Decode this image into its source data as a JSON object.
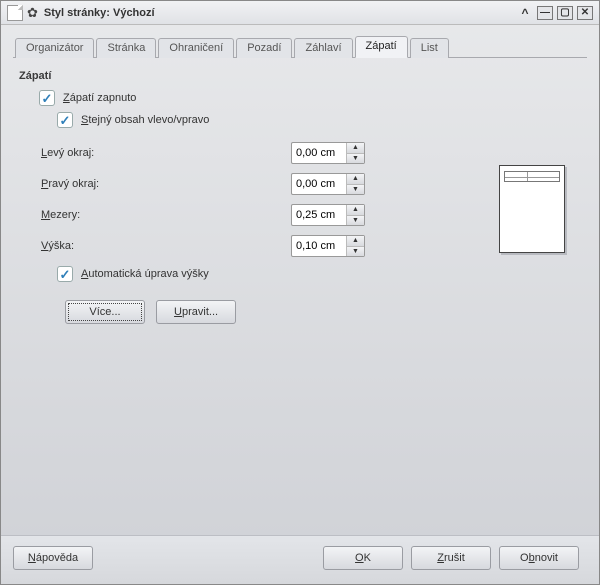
{
  "window": {
    "title": "Styl stránky: Výchozí",
    "btn_roll": "^",
    "btn_min": "—",
    "btn_max": "▢",
    "btn_close": "✕"
  },
  "tabs": {
    "items": [
      {
        "label": "Organizátor"
      },
      {
        "label": "Stránka"
      },
      {
        "label": "Ohraničení"
      },
      {
        "label": "Pozadí"
      },
      {
        "label": "Záhlaví"
      },
      {
        "label": "Zápatí"
      },
      {
        "label": "List"
      }
    ],
    "active_index": 5
  },
  "panel": {
    "title": "Zápatí",
    "footer_on": {
      "checked": true,
      "pre": "Z",
      "rest": "ápatí zapnuto"
    },
    "same_content": {
      "checked": true,
      "pre": "S",
      "rest": "tejný obsah vlevo/vpravo"
    },
    "fields": {
      "left": {
        "pre": "L",
        "rest": "evý okraj:",
        "value": "0,00 cm"
      },
      "right": {
        "pre": "P",
        "rest": "ravý okraj:",
        "value": "0,00 cm"
      },
      "spacing": {
        "pre": "M",
        "rest": "ezery:",
        "value": "0,25 cm"
      },
      "height": {
        "pre": "V",
        "rest": "ýška:",
        "value": "0,10 cm"
      }
    },
    "auto_height": {
      "checked": true,
      "pre": "A",
      "rest": "utomatická úprava výšky"
    },
    "buttons": {
      "more": {
        "pre": "V",
        "mid": "íc",
        "post": "e...",
        "dotted": true
      },
      "edit": {
        "pre": "U",
        "rest": "pravit..."
      }
    }
  },
  "footer": {
    "help": {
      "pre": "N",
      "rest": "ápověda"
    },
    "ok": {
      "pre": "O",
      "rest": "K"
    },
    "cancel": {
      "pre": "Z",
      "rest": "rušit"
    },
    "reset": {
      "pre": "O",
      "mid": "b",
      "post": "novit"
    }
  }
}
